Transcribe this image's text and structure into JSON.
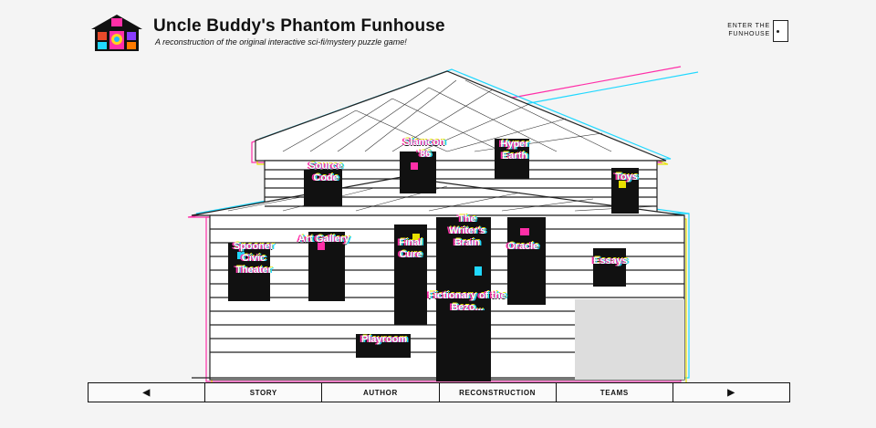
{
  "site": {
    "title": "Uncle Buddy's Phantom Funhouse",
    "subtitle": "A reconstruction of the original interactive sci-fi/mystery puzzle game!",
    "logo_icon": "funhouse-logo-icon"
  },
  "enter": {
    "label": "ENTER THE FUNHOUSE"
  },
  "rooms": [
    {
      "label": "Slamcon '86"
    },
    {
      "label": "Hyper Earth"
    },
    {
      "label": "Source Code"
    },
    {
      "label": "Art Gallery"
    },
    {
      "label": "Final Cure"
    },
    {
      "label": "The Writer's Brain"
    },
    {
      "label": "Oracle"
    },
    {
      "label": "Essays"
    },
    {
      "label": "Spooner Civic Theater"
    },
    {
      "label": "Fictionary of the Bezo..."
    },
    {
      "label": "Playroom"
    },
    {
      "label": "Toys"
    }
  ],
  "nav": {
    "prev_icon": "arrow-left-icon",
    "prev": "◀",
    "story": "STORY",
    "author": "AUTHOR",
    "reconstruction": "RECONSTRUCTION",
    "teams": "TEAMS",
    "next_icon": "arrow-right-icon",
    "next": "▶"
  },
  "colors": {
    "background": "#f4f4f4",
    "glitch_magenta": "#ff2fa8",
    "glitch_cyan": "#20d8ff",
    "glitch_yellow": "#e8e000",
    "line": "#111111"
  }
}
